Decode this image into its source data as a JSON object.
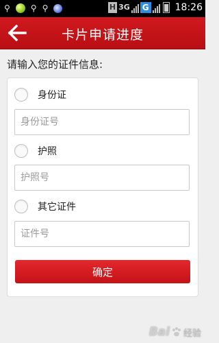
{
  "status_bar": {
    "network_label": "3G",
    "carrier_badge": "H",
    "data_badge": "G",
    "time": "18:26",
    "icons": [
      "usb-icon",
      "green-app-icon",
      "usb-icon",
      "usb-icon",
      "blue-app-icon",
      "signal-icon",
      "battery-icon"
    ]
  },
  "header": {
    "title": "卡片申请进度",
    "back_icon": "arrow-left-icon"
  },
  "form": {
    "prompt": "请输入您的证件信息:",
    "options": [
      {
        "label": "身份证",
        "placeholder": "身份证号"
      },
      {
        "label": "护照",
        "placeholder": "护照号"
      },
      {
        "label": "其它证件",
        "placeholder": "证件号"
      }
    ],
    "submit_label": "确定"
  },
  "watermark": {
    "brand": "Bai",
    "suffix": "经验"
  },
  "colors": {
    "accent_red": "#c8141a",
    "background": "#efefef"
  }
}
